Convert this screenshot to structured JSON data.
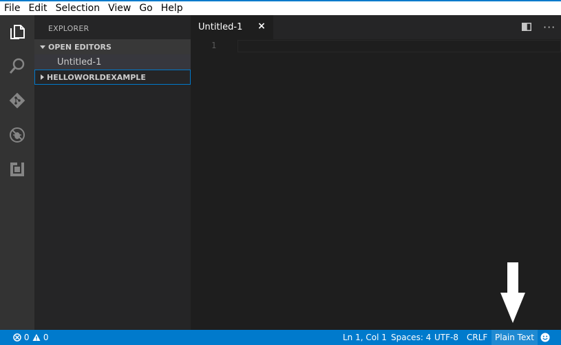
{
  "menubar": {
    "items": [
      "File",
      "Edit",
      "Selection",
      "View",
      "Go",
      "Help"
    ]
  },
  "activitybar": {
    "icons": [
      "explorer-icon",
      "search-icon",
      "source-control-icon",
      "debug-icon",
      "extensions-icon"
    ]
  },
  "sidebar": {
    "title": "EXPLORER",
    "open_editors": "OPEN EDITORS",
    "open_file": "Untitled-1",
    "folder": "HELLOWORLDEXAMPLE"
  },
  "tab": {
    "label": "Untitled-1",
    "close": "×"
  },
  "editor": {
    "line_number": "1"
  },
  "status": {
    "errors": "0",
    "warnings": "0",
    "position": "Ln 1, Col 1",
    "spaces": "Spaces: 4",
    "encoding": "UTF-8",
    "eol": "CRLF",
    "language": "Plain Text"
  },
  "colors": {
    "accent": "#007acc",
    "sidebar": "#252526",
    "activitybar": "#333333",
    "editor": "#1e1e1e"
  }
}
